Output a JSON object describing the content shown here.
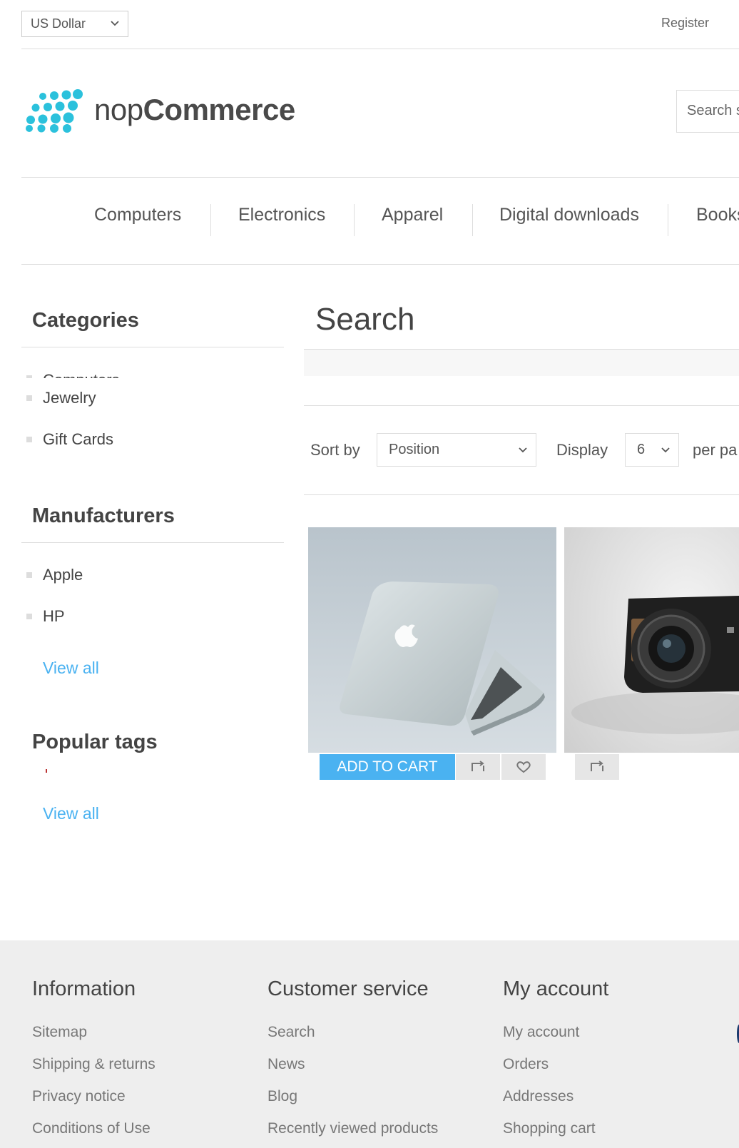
{
  "header": {
    "currency": "US Dollar",
    "register": "Register",
    "logo": {
      "prefix": "nop",
      "brand": "Commerce",
      "color": "#2bc1dc"
    },
    "search_placeholder": "Search s"
  },
  "menu": [
    "Computers",
    "Electronics",
    "Apparel",
    "Digital downloads",
    "Books"
  ],
  "sidebar": {
    "categories": {
      "title": "Categories",
      "partial_item": "Computers",
      "items": [
        "Jewelry",
        "Gift Cards"
      ]
    },
    "manufacturers": {
      "title": "Manufacturers",
      "items": [
        "Apple",
        "HP"
      ],
      "view_all": "View all"
    },
    "popular_tags": {
      "title": "Popular tags",
      "view_all": "View all"
    }
  },
  "main": {
    "title": "Search",
    "sort_label": "Sort by",
    "sort_value": "Position",
    "display_label": "Display",
    "display_value": "6",
    "per_page": "per pa",
    "add_to_cart": "ADD TO CART"
  },
  "footer": {
    "columns": [
      {
        "title": "Information",
        "links": [
          "Sitemap",
          "Shipping & returns",
          "Privacy notice",
          "Conditions of Use"
        ]
      },
      {
        "title": "Customer service",
        "links": [
          "Search",
          "News",
          "Blog",
          "Recently viewed products"
        ]
      },
      {
        "title": "My account",
        "links": [
          "My account",
          "Orders",
          "Addresses",
          "Shopping cart"
        ]
      }
    ]
  },
  "colors": {
    "accent": "#4ab2f1",
    "footer_bg": "#eeeeee"
  }
}
